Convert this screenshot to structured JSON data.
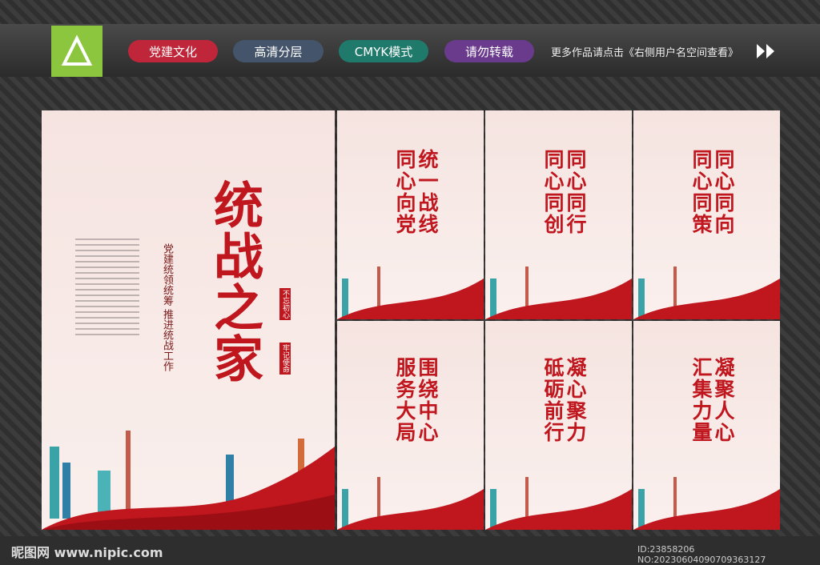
{
  "topbar": {
    "pills": [
      "党建文化",
      "高清分层",
      "CMYK模式",
      "请勿转载"
    ],
    "more_text": "更多作品请点击《右侧用户名空间查看》"
  },
  "big_poster": {
    "title": "统战之家",
    "subtitle": "党建统领统筹 推进统战工作",
    "stamp1": "不忘初心",
    "stamp2": "牢记使命"
  },
  "small_posters": [
    {
      "title1": "统一战线",
      "title2": "同心向党"
    },
    {
      "title1": "同心同行",
      "title2": "同心同创"
    },
    {
      "title1": "同心同向",
      "title2": "同心同策"
    },
    {
      "title1": "围绕中心",
      "title2": "服务大局"
    },
    {
      "title1": "凝心聚力",
      "title2": "砥砺前行"
    },
    {
      "title1": "凝聚人心",
      "title2": "汇集力量"
    }
  ],
  "footer": {
    "site": "昵图网 www.nipic.com",
    "id": "ID:23858206 NO:20230604090709363127"
  },
  "colors": {
    "red": "#c0161e",
    "green": "#8cc63f"
  }
}
